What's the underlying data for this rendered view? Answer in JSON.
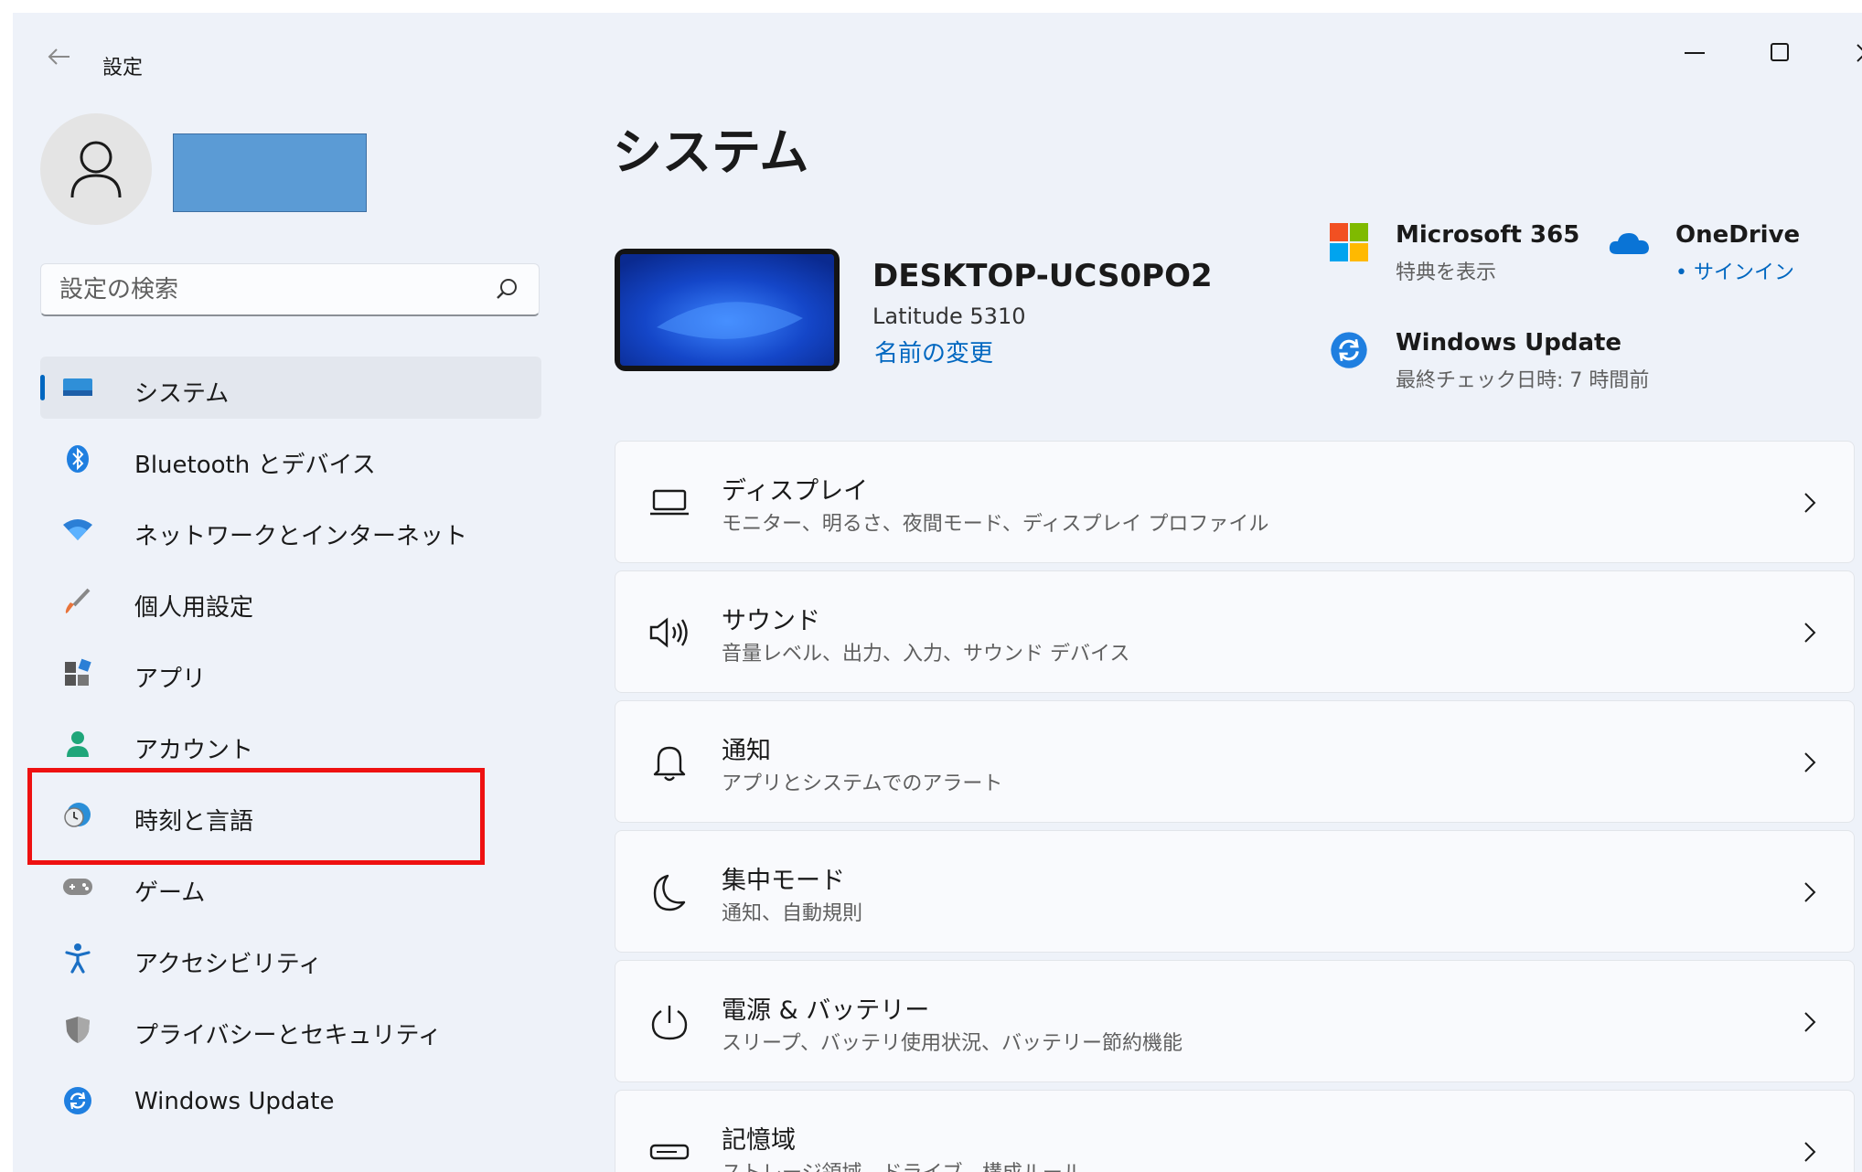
{
  "window": {
    "title": "設定",
    "back_icon": "back-arrow-icon",
    "minimize_icon": "minimize-icon",
    "maximize_icon": "maximize-icon",
    "close_icon": "close-icon"
  },
  "user": {
    "avatar_icon": "person-icon",
    "name_redacted_color": "#5b9bd5"
  },
  "search": {
    "placeholder": "設定の検索",
    "icon": "search-icon"
  },
  "sidebar": {
    "items": [
      {
        "label": "システム",
        "icon": "system-icon",
        "selected": true
      },
      {
        "label": "Bluetooth とデバイス",
        "icon": "bluetooth-icon"
      },
      {
        "label": "ネットワークとインターネット",
        "icon": "wifi-icon"
      },
      {
        "label": "個人用設定",
        "icon": "brush-icon"
      },
      {
        "label": "アプリ",
        "icon": "apps-icon"
      },
      {
        "label": "アカウント",
        "icon": "account-icon"
      },
      {
        "label": "時刻と言語",
        "icon": "time-language-icon",
        "highlighted": true
      },
      {
        "label": "ゲーム",
        "icon": "gamepad-icon"
      },
      {
        "label": "アクセシビリティ",
        "icon": "accessibility-icon"
      },
      {
        "label": "プライバシーとセキュリティ",
        "icon": "shield-icon"
      },
      {
        "label": "Windows Update",
        "icon": "windows-update-icon"
      }
    ]
  },
  "main": {
    "title": "システム",
    "device": {
      "name": "DESKTOP-UCS0PO2",
      "model": "Latitude 5310",
      "rename": "名前の変更"
    },
    "quick_links": {
      "m365": {
        "title": "Microsoft 365",
        "subtitle": "特典を表示",
        "icon": "microsoft-logo-icon"
      },
      "onedrive": {
        "title": "OneDrive",
        "subtitle": "• サインイン",
        "icon": "onedrive-cloud-icon"
      },
      "winupdate": {
        "title": "Windows Update",
        "subtitle": "最終チェック日時: 7 時間前",
        "icon": "windows-update-icon"
      }
    },
    "cards": [
      {
        "title": "ディスプレイ",
        "subtitle": "モニター、明るさ、夜間モード、ディスプレイ プロファイル",
        "icon": "display-icon"
      },
      {
        "title": "サウンド",
        "subtitle": "音量レベル、出力、入力、サウンド デバイス",
        "icon": "speaker-icon"
      },
      {
        "title": "通知",
        "subtitle": "アプリとシステムでのアラート",
        "icon": "bell-icon"
      },
      {
        "title": "集中モード",
        "subtitle": "通知、自動規則",
        "icon": "moon-icon"
      },
      {
        "title": "電源 & バッテリー",
        "subtitle": "スリープ、バッテリ使用状況、バッテリー節約機能",
        "icon": "power-icon"
      },
      {
        "title": "記憶域",
        "subtitle": "ストレージ領域、ドライブ、構成ルール",
        "icon": "storage-icon"
      }
    ]
  },
  "colors": {
    "accent": "#0067c0",
    "window_background": "#eef2f9",
    "card_background": "#f9fafd",
    "highlight_border": "#ee1111"
  }
}
